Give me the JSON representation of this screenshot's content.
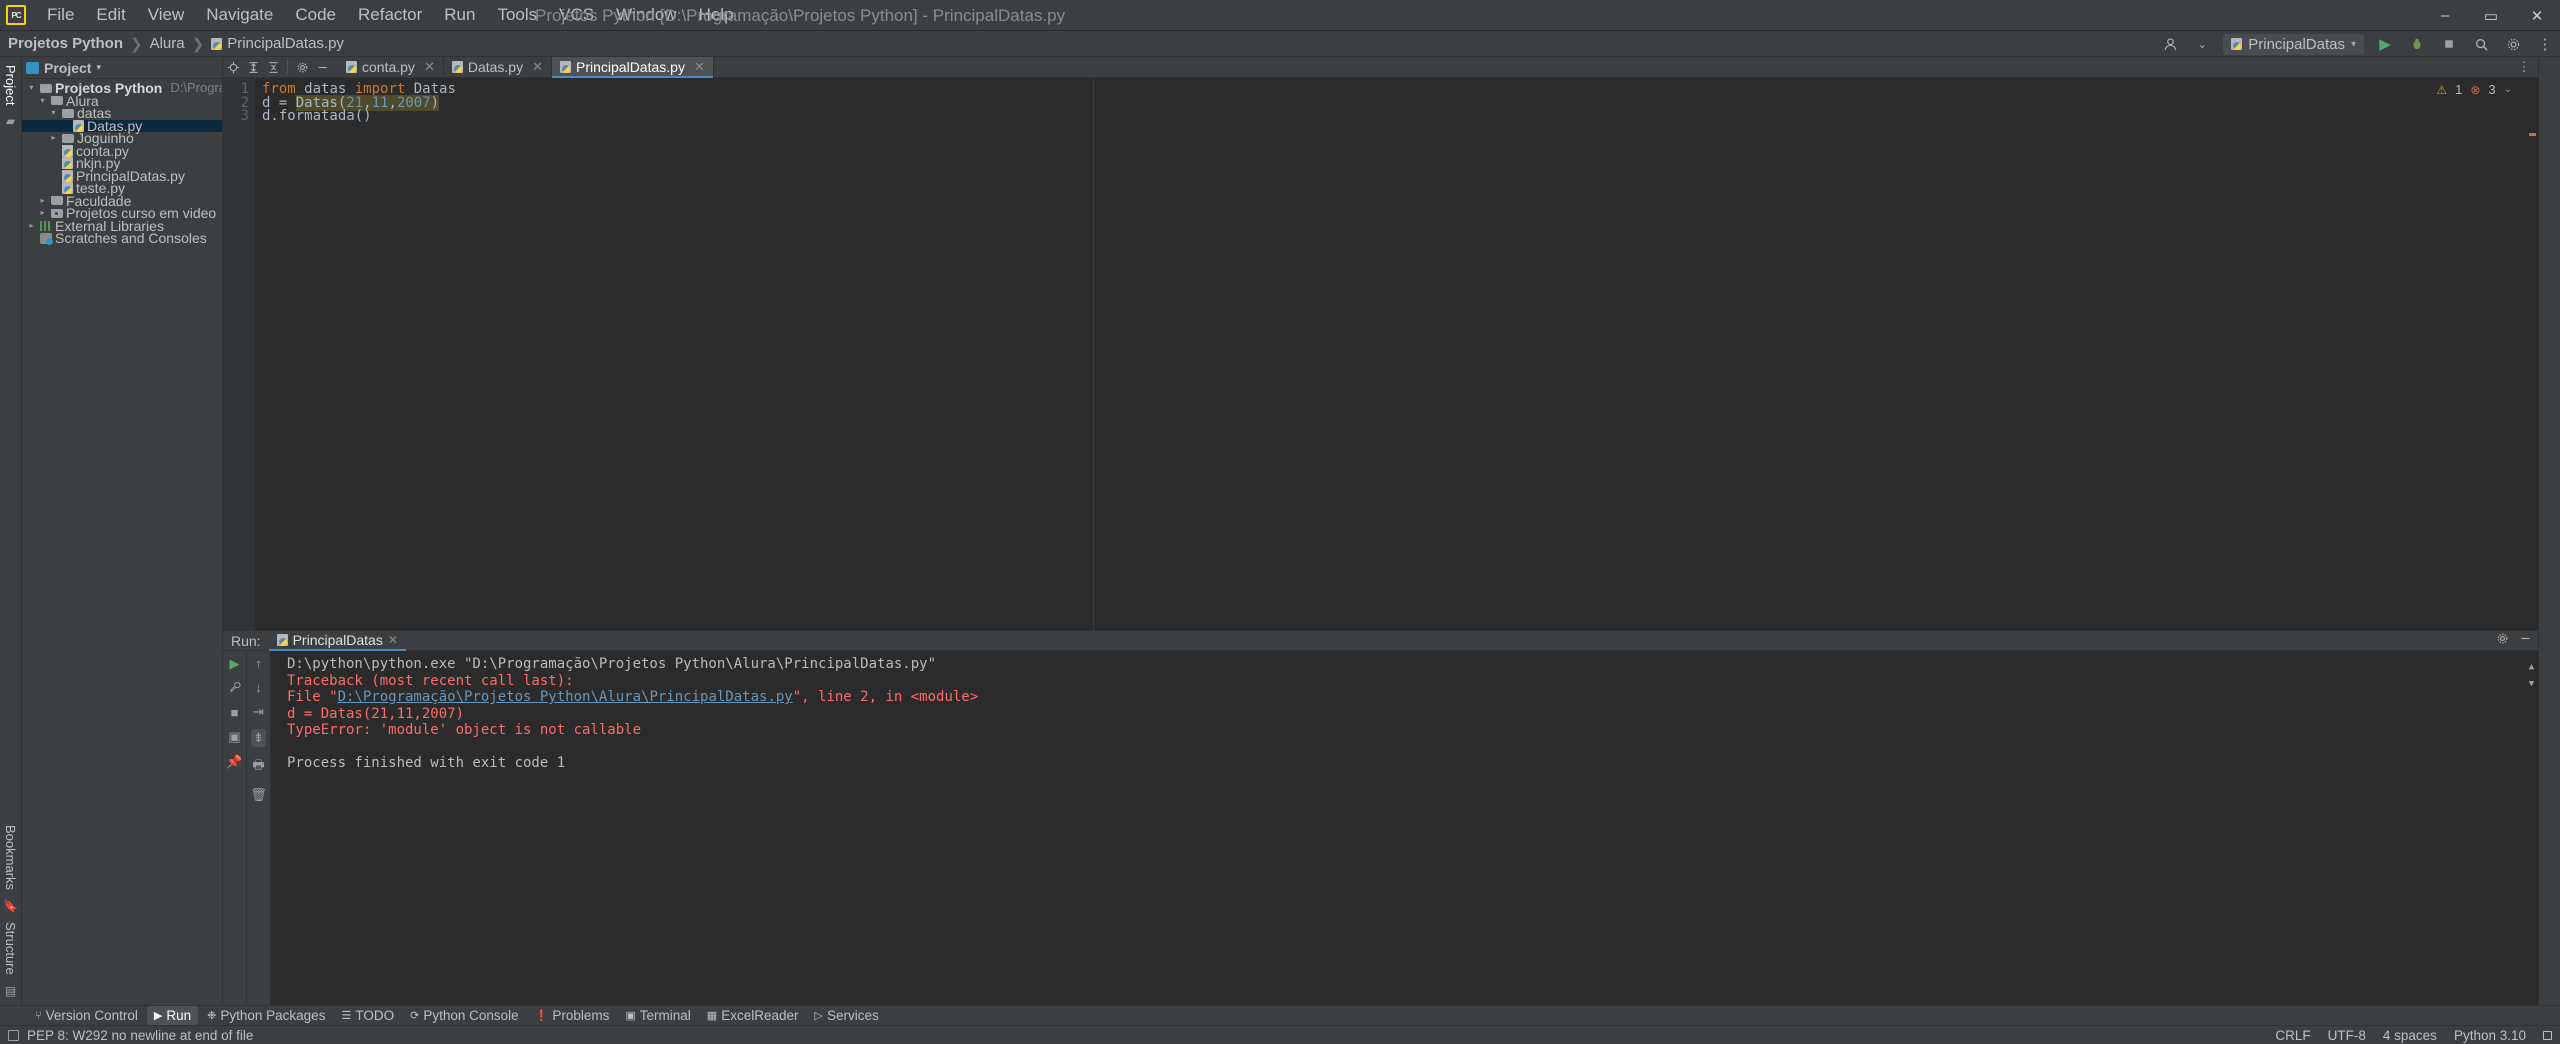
{
  "window": {
    "title": "Projetos Python [D:\\Programação\\Projetos Python] - PrincipalDatas.py",
    "logo": "PC",
    "minimize": "–",
    "maximize": "▭",
    "close": "✕"
  },
  "menu": {
    "items": [
      {
        "label": "File"
      },
      {
        "label": "Edit"
      },
      {
        "label": "View"
      },
      {
        "label": "Navigate"
      },
      {
        "label": "Code"
      },
      {
        "label": "Refactor"
      },
      {
        "label": "Run"
      },
      {
        "label": "Tools"
      },
      {
        "label": "VCS"
      },
      {
        "label": "Window"
      },
      {
        "label": "Help"
      }
    ]
  },
  "breadcrumb": {
    "items": [
      {
        "label": "Projetos Python",
        "bold": true
      },
      {
        "label": "Alura",
        "bold": false
      },
      {
        "label": "PrincipalDatas.py",
        "bold": false,
        "icon": "python-file-icon"
      }
    ],
    "separator": "❯"
  },
  "navbar_right": {
    "account_icon": "account-icon",
    "chevron": "⌄",
    "run_config": "PrincipalDatas",
    "run_config_chevron": "▾",
    "run_button": "▶",
    "debug_button": "🐞",
    "stop_button": "■",
    "search_icon": "🔍",
    "settings_icon": "⚙",
    "more_icon": "⋮"
  },
  "sidebar": {
    "vertical_tabs": [
      {
        "label": "Project",
        "selected": true
      },
      {
        "label": "Structure",
        "selected": false
      },
      {
        "label": "Bookmarks",
        "selected": false
      }
    ],
    "panel_title": "Project",
    "panel_chevron": "▾",
    "panel_toolbar": [
      {
        "name": "locate-icon",
        "glyph": "⊕"
      },
      {
        "name": "expand-all-icon",
        "glyph": "⇕"
      },
      {
        "name": "collapse-all-icon",
        "glyph": "⇅"
      },
      {
        "name": "settings-icon",
        "glyph": "⚙"
      },
      {
        "name": "hide-icon",
        "glyph": "—"
      }
    ],
    "tree": [
      {
        "depth": 0,
        "arrow": "open",
        "icon": "folder",
        "label": "Projetos Python",
        "bold": true,
        "path": "D:\\Programação\\Projetos Python",
        "selected": false
      },
      {
        "depth": 1,
        "arrow": "open",
        "icon": "folder",
        "label": "Alura",
        "bold": false,
        "path": "",
        "selected": false
      },
      {
        "depth": 2,
        "arrow": "open",
        "icon": "folder",
        "label": "datas",
        "bold": false,
        "path": "",
        "selected": false
      },
      {
        "depth": 3,
        "arrow": "blank",
        "icon": "python",
        "label": "Datas.py",
        "bold": false,
        "path": "",
        "selected": true
      },
      {
        "depth": 2,
        "arrow": "closed",
        "icon": "folder",
        "label": "Joguinho",
        "bold": false,
        "path": "",
        "selected": false
      },
      {
        "depth": 2,
        "arrow": "blank",
        "icon": "python",
        "label": "conta.py",
        "bold": false,
        "path": "",
        "selected": false
      },
      {
        "depth": 2,
        "arrow": "blank",
        "icon": "python",
        "label": "nkjn.py",
        "bold": false,
        "path": "",
        "selected": false
      },
      {
        "depth": 2,
        "arrow": "blank",
        "icon": "python",
        "label": "PrincipalDatas.py",
        "bold": false,
        "path": "",
        "selected": false
      },
      {
        "depth": 2,
        "arrow": "blank",
        "icon": "python",
        "label": "teste.py",
        "bold": false,
        "path": "",
        "selected": false
      },
      {
        "depth": 1,
        "arrow": "closed",
        "icon": "folder",
        "label": "Faculdade",
        "bold": false,
        "path": "",
        "selected": false
      },
      {
        "depth": 1,
        "arrow": "closed",
        "icon": "module",
        "label": "Projetos curso em video",
        "bold": false,
        "path": "",
        "selected": false
      },
      {
        "depth": 0,
        "arrow": "closed",
        "icon": "libs",
        "label": "External Libraries",
        "bold": false,
        "path": "",
        "selected": false
      },
      {
        "depth": 0,
        "arrow": "blank",
        "icon": "scratches",
        "label": "Scratches and Consoles",
        "bold": false,
        "path": "",
        "selected": false
      }
    ]
  },
  "editor": {
    "toolbar": [
      {
        "name": "locate-file-icon",
        "glyph": "⊕"
      },
      {
        "name": "expand-all-icon",
        "glyph": "⇕"
      },
      {
        "name": "collapse-all-icon",
        "glyph": "⇅"
      },
      {
        "name": "settings-icon",
        "glyph": "⚙"
      },
      {
        "name": "hide-panel-icon",
        "glyph": "—"
      }
    ],
    "tabs": [
      {
        "label": "conta.py",
        "active": false,
        "close": "✕"
      },
      {
        "label": "Datas.py",
        "active": false,
        "close": "✕"
      },
      {
        "label": "PrincipalDatas.py",
        "active": true,
        "close": "✕"
      }
    ],
    "line_numbers": [
      "1",
      "2",
      "3"
    ],
    "code_lines": [
      {
        "tokens": [
          {
            "t": "from ",
            "c": "kw"
          },
          {
            "t": "datas ",
            "c": "plain"
          },
          {
            "t": "import ",
            "c": "kw"
          },
          {
            "t": "Datas",
            "c": "plain"
          }
        ]
      },
      {
        "tokens": [
          {
            "t": "d = ",
            "c": "plain"
          },
          {
            "t": "Datas(",
            "c": "err"
          },
          {
            "t": "21",
            "c": "errnum"
          },
          {
            "t": ",",
            "c": "err"
          },
          {
            "t": "11",
            "c": "errnum"
          },
          {
            "t": ",",
            "c": "err"
          },
          {
            "t": "2007",
            "c": "errnum"
          },
          {
            "t": ")",
            "c": "err"
          }
        ]
      },
      {
        "tokens": [
          {
            "t": "d.formatada()",
            "c": "plain"
          }
        ]
      }
    ],
    "inspections": {
      "warning_icon": "⚠",
      "warning_count": "1",
      "error_icon": "⊗",
      "error_count": "3",
      "chevron": "⌄"
    }
  },
  "run_panel": {
    "label": "Run:",
    "tab_label": "PrincipalDatas",
    "tab_close": "✕",
    "settings_icon": "⚙",
    "hide_icon": "—",
    "toolbar_left": [
      {
        "name": "rerun-icon",
        "glyph": "▶"
      },
      {
        "name": "wrench-icon",
        "glyph": "🔧"
      },
      {
        "name": "stop-icon",
        "glyph": "■"
      },
      {
        "name": "layout-icon",
        "glyph": "▣"
      },
      {
        "name": "pin-icon",
        "glyph": "📌"
      }
    ],
    "toolbar_right": [
      {
        "name": "up-arrow-icon",
        "glyph": "↑"
      },
      {
        "name": "down-arrow-icon",
        "glyph": "↓"
      },
      {
        "name": "soft-wrap-icon",
        "glyph": "⇥"
      },
      {
        "name": "scroll-end-icon",
        "glyph": "⇟"
      },
      {
        "name": "print-icon",
        "glyph": "🖶"
      },
      {
        "name": "trash-icon",
        "glyph": "🗑"
      }
    ],
    "console_lines": [
      {
        "segments": [
          {
            "t": "D:\\python\\python.exe \"D:\\Programação\\Projetos Python\\Alura\\PrincipalDatas.py\"",
            "c": "white"
          }
        ]
      },
      {
        "segments": [
          {
            "t": "Traceback (most recent call last):",
            "c": "red"
          }
        ]
      },
      {
        "segments": [
          {
            "t": "  File \"",
            "c": "red"
          },
          {
            "t": "D:\\Programação\\Projetos Python\\Alura\\PrincipalDatas.py",
            "c": "link"
          },
          {
            "t": "\", line 2, in <module>",
            "c": "red"
          }
        ]
      },
      {
        "segments": [
          {
            "t": "    d = Datas(21,11,2007)",
            "c": "red"
          }
        ]
      },
      {
        "segments": [
          {
            "t": "TypeError: 'module' object is not callable",
            "c": "red"
          }
        ]
      },
      {
        "segments": [
          {
            "t": "",
            "c": "white"
          }
        ]
      },
      {
        "segments": [
          {
            "t": "Process finished with exit code 1",
            "c": "white"
          }
        ]
      }
    ]
  },
  "tool_window_bar": {
    "items": [
      {
        "label": "Version Control",
        "icon": "branch-icon",
        "glyph": "⑂",
        "active": false
      },
      {
        "label": "Run",
        "icon": "run-icon",
        "glyph": "▶",
        "active": true
      },
      {
        "label": "Python Packages",
        "icon": "packages-icon",
        "glyph": "❉",
        "active": false
      },
      {
        "label": "TODO",
        "icon": "todo-icon",
        "glyph": "☰",
        "active": false
      },
      {
        "label": "Python Console",
        "icon": "console-icon",
        "glyph": "⟳",
        "active": false
      },
      {
        "label": "Problems",
        "icon": "problems-icon",
        "glyph": "❗",
        "active": false
      },
      {
        "label": "Terminal",
        "icon": "terminal-icon",
        "glyph": "▣",
        "active": false
      },
      {
        "label": "ExcelReader",
        "icon": "excel-icon",
        "glyph": "▦",
        "active": false
      },
      {
        "label": "Services",
        "icon": "services-icon",
        "glyph": "▷",
        "active": false
      }
    ]
  },
  "status_bar": {
    "message": "PEP 8: W292 no newline at end of file",
    "message_icon": "inspection-icon",
    "right_items": [
      {
        "label": "CRLF"
      },
      {
        "label": "UTF-8"
      },
      {
        "label": "4 spaces"
      },
      {
        "label": "Python 3.10"
      }
    ],
    "lock_icon": "lock-icon"
  },
  "colors": {
    "bg_chrome": "#3c3f41",
    "bg_editor": "#2b2b2b",
    "accent_blue": "#4a88c7",
    "selection_blue": "#0d293e",
    "error_red": "#ff6b68",
    "keyword_orange": "#cc7832",
    "number_blue": "#6897bb",
    "text": "#bbbbbb"
  }
}
